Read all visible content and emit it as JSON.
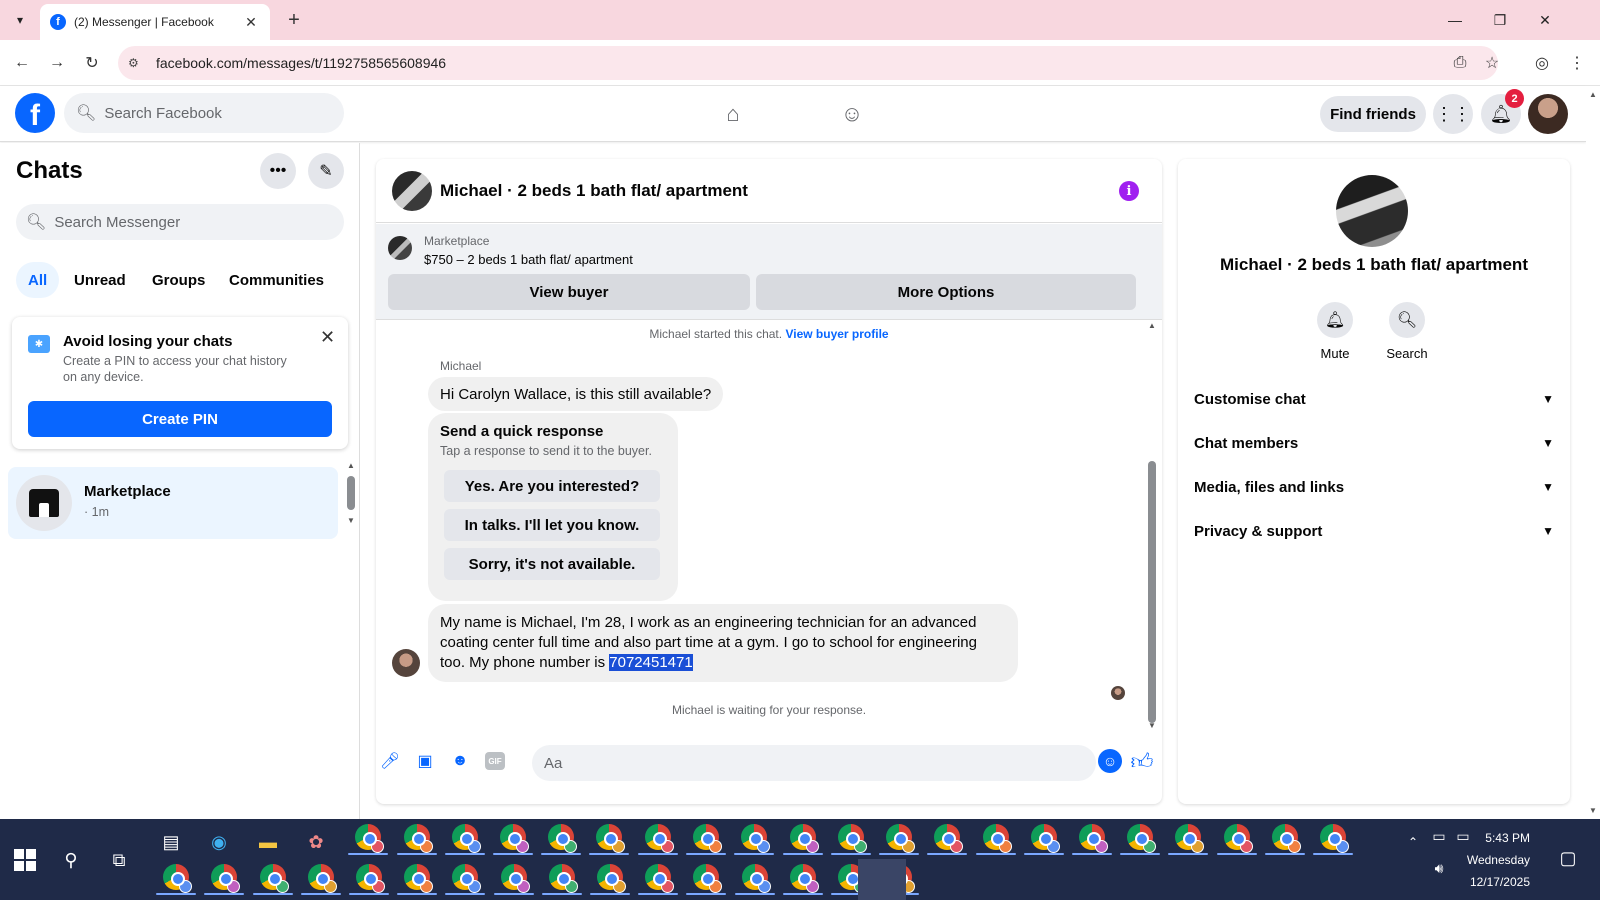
{
  "browser": {
    "tab_title": "(2) Messenger | Facebook",
    "url": "facebook.com/messages/t/1192758565608946",
    "icons": [
      "tab-list-icon",
      "close-icon",
      "plus-icon",
      "minimize-icon",
      "restore-icon",
      "back-icon",
      "forward-icon",
      "reload-icon",
      "site-settings-icon",
      "install-icon",
      "star-icon",
      "profile-icon",
      "menu-icon"
    ]
  },
  "fb_header": {
    "logo": "f",
    "search_placeholder": "Search Facebook",
    "find_friends": "Find friends",
    "notification_count": "2"
  },
  "sidebar": {
    "title": "Chats",
    "search_placeholder": "Search Messenger",
    "filters": [
      "All",
      "Unread",
      "Groups",
      "Communities"
    ],
    "pin_card": {
      "title": "Avoid losing your chats",
      "description": "Create a PIN to access your chat history on any device.",
      "button": "Create PIN"
    },
    "conversation": {
      "name": "Marketplace",
      "time": "· 1m"
    }
  },
  "chat": {
    "title": "Michael · 2 beds 1 bath flat/ apartment",
    "marketplace_label": "Marketplace",
    "listing": "$750 – 2 beds 1 bath flat/ apartment",
    "view_buyer": "View buyer",
    "more_options": "More Options",
    "started_note": "Michael started this chat.",
    "view_buyer_profile": "View buyer profile",
    "sender": "Michael",
    "message1": "Hi Carolyn Wallace, is this still available?",
    "quick_response": {
      "title": "Send a quick response",
      "subtitle": "Tap a response to send it to the buyer.",
      "options": [
        "Yes. Are you interested?",
        "In talks. I'll let you know.",
        "Sorry, it's not available."
      ]
    },
    "message2_prefix": "My name is Michael, I'm 28, I work as an engineering technician for an advanced coating center full time and also part time at a gym. I go to school for engineering too. My phone number is ",
    "message2_phone": "7072451471",
    "waiting_note": "Michael is waiting for your response.",
    "composer_placeholder": "Aa",
    "composer_icons": [
      "mic-icon",
      "photo-icon",
      "sticker-icon",
      "gif-icon",
      "emoji-icon",
      "thumbs-up-icon"
    ],
    "gif_label": "GIF"
  },
  "right_panel": {
    "title": "Michael · 2 beds 1 bath flat/ apartment",
    "actions": [
      {
        "label": "Mute",
        "icon": "bell-icon"
      },
      {
        "label": "Search",
        "icon": "search-icon"
      }
    ],
    "sections": [
      "Customise chat",
      "Chat members",
      "Media, files and links",
      "Privacy & support"
    ]
  },
  "taskbar": {
    "time": "5:43 PM",
    "day": "Wednesday",
    "date": "12/17/2025"
  },
  "colors": {
    "fb_blue": "#0866ff",
    "tabbar_pink": "#f8d7df",
    "taskbar": "#1f2a48",
    "highlight": "#1a4fd6"
  }
}
